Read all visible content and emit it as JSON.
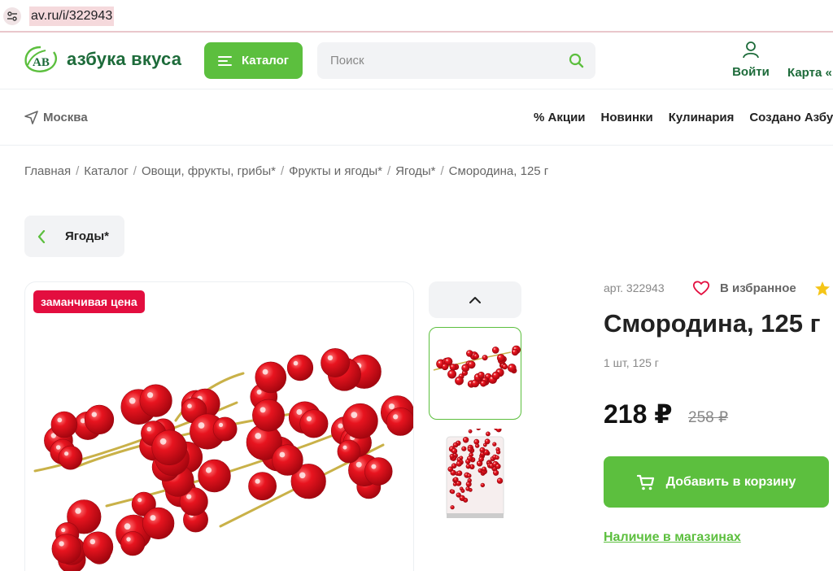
{
  "browser": {
    "url": "av.ru/i/322943"
  },
  "header": {
    "logo_text": "азбука вкуса",
    "logo_mark": "АВ",
    "catalog_label": "Каталог",
    "search_placeholder": "Поиск",
    "login_label": "Войти",
    "card_label": "Карта «"
  },
  "subnav": {
    "city": "Москва",
    "links": [
      "% Акции",
      "Новинки",
      "Кулинария",
      "Создано Азбук"
    ]
  },
  "breadcrumb": [
    "Главная",
    "Каталог",
    "Овощи, фрукты, грибы*",
    "Фрукты и ягоды*",
    "Ягоды*",
    "Смородина, 125 г"
  ],
  "back_label": "Ягоды*",
  "product": {
    "promo_badge": "заманчивая цена",
    "article": "арт. 322943",
    "favorite_label": "В избранное",
    "title": "Смородина, 125 г",
    "unit": "1 шт, 125 г",
    "price": "218 ₽",
    "old_price": "258 ₽",
    "add_to_cart": "Добавить в корзину",
    "availability": "Наличие в магазинах"
  },
  "colors": {
    "brand_green": "#5cbf3e",
    "dark_green": "#1d6b3a",
    "promo_red": "#e30e3f",
    "berry_red": "#d8101e"
  },
  "icons": [
    "tune-icon",
    "logo-icon",
    "menu-icon",
    "search-icon",
    "user-icon",
    "location-arrow-icon",
    "chevron-left-icon",
    "chevron-up-icon",
    "heart-icon",
    "star-icon",
    "cart-icon"
  ]
}
